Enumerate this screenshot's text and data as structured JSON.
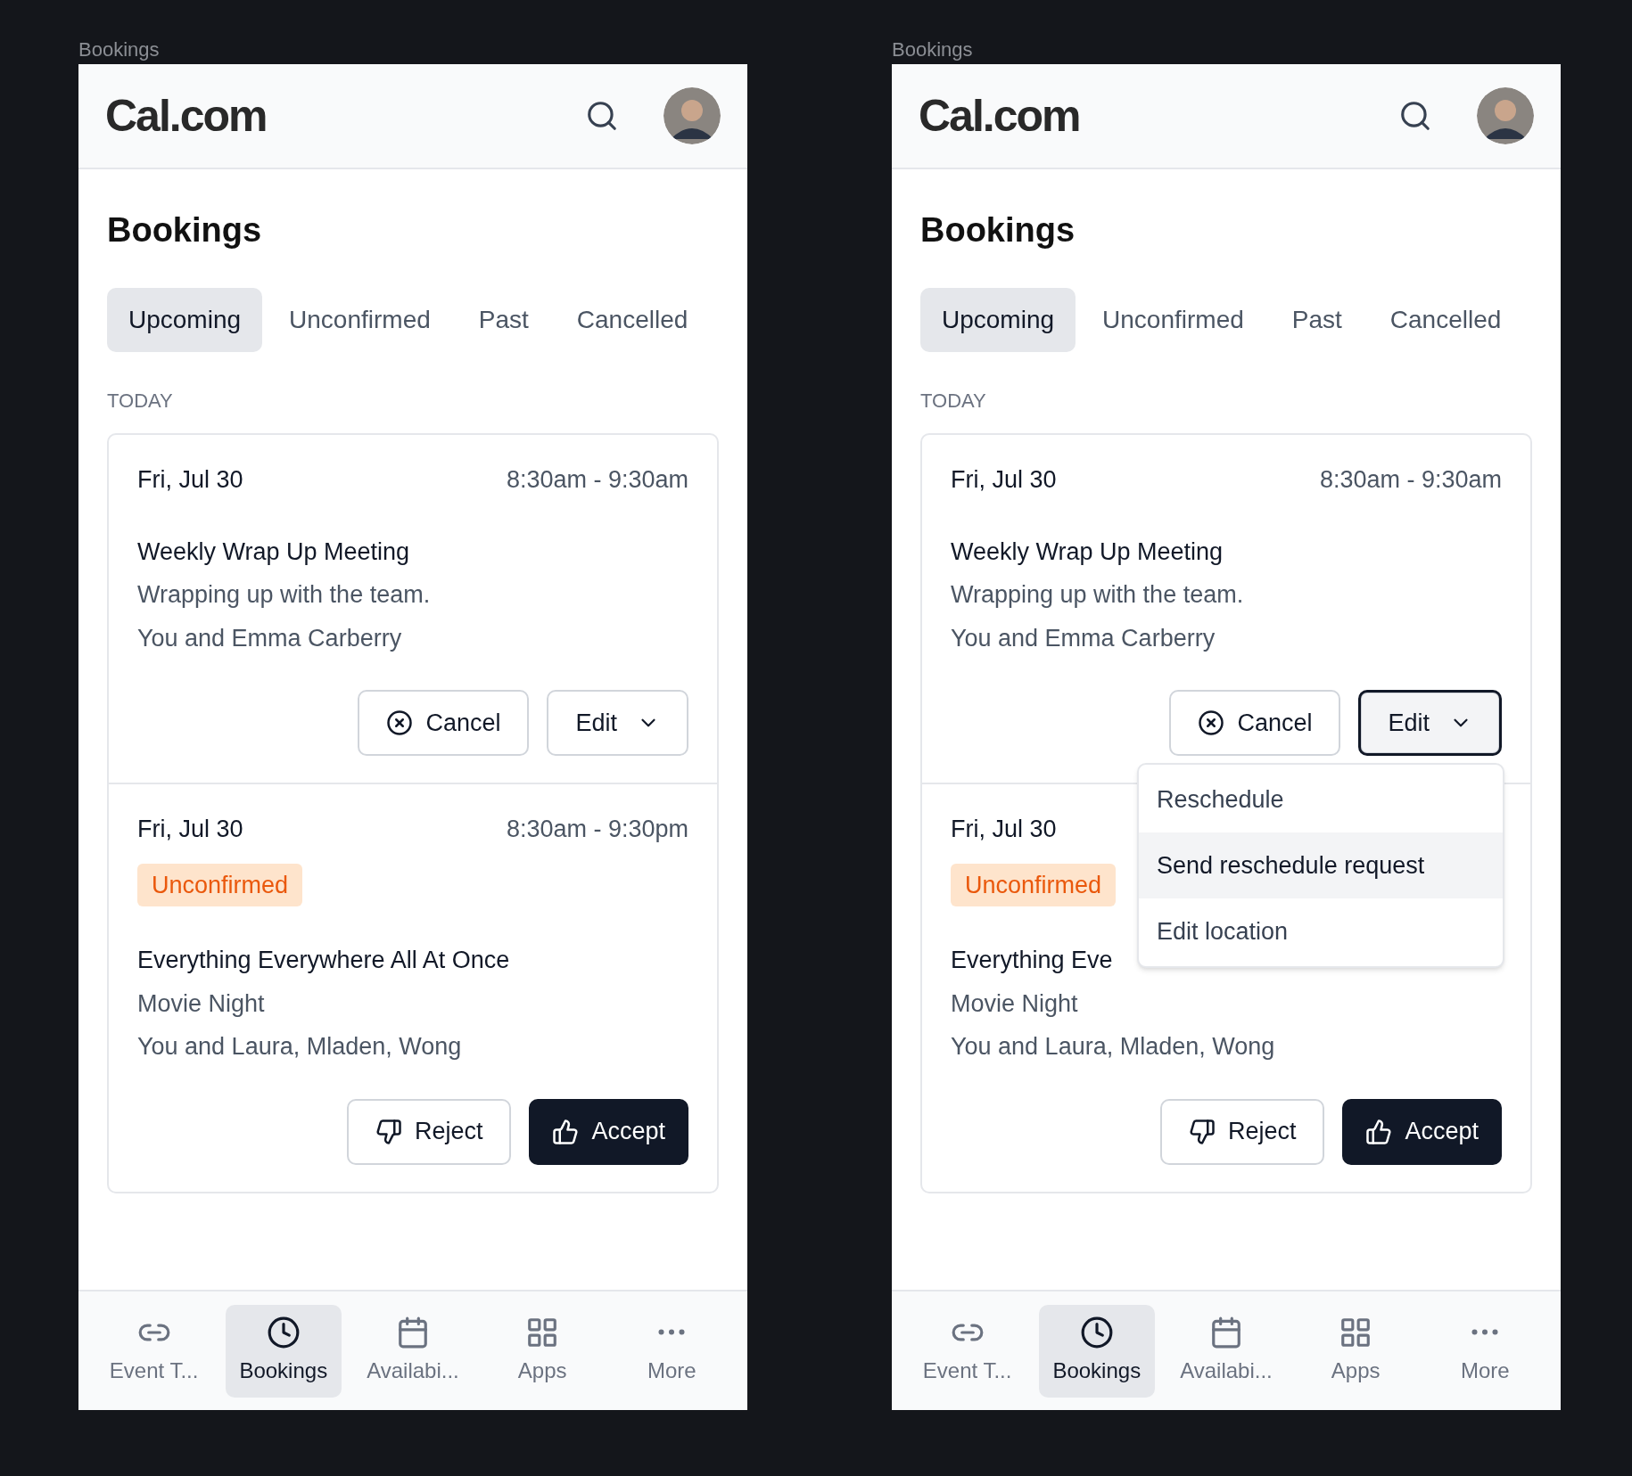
{
  "screens": [
    {
      "caption": "Bookings",
      "logo": "Cal.com",
      "title": "Bookings",
      "tabs": [
        {
          "label": "Upcoming",
          "selected": true
        },
        {
          "label": "Unconfirmed",
          "selected": false
        },
        {
          "label": "Past",
          "selected": false
        },
        {
          "label": "Cancelled",
          "selected": false
        }
      ],
      "section": "TODAY",
      "bookings": [
        {
          "date": "Fri, Jul 30",
          "time": "8:30am - 9:30am",
          "title": "Weekly Wrap Up Meeting",
          "description": "Wrapping up with the team.",
          "attendees": "You and Emma Carberry",
          "actions": [
            {
              "label": "Cancel",
              "kind": "cancel"
            },
            {
              "label": "Edit",
              "kind": "menu",
              "open": false
            }
          ]
        },
        {
          "date": "Fri, Jul 30",
          "time": "8:30am - 9:30pm",
          "badge": "Unconfirmed",
          "title": "Everything Everywhere All At Once",
          "description": "Movie Night",
          "attendees": "You and Laura, Mladen, Wong",
          "actions": [
            {
              "label": "Reject",
              "kind": "reject"
            },
            {
              "label": "Accept",
              "kind": "accept"
            }
          ]
        }
      ],
      "nav": [
        {
          "label": "Event T...",
          "kind": "link",
          "selected": false
        },
        {
          "label": "Bookings",
          "kind": "clock",
          "selected": true
        },
        {
          "label": "Availabi...",
          "kind": "calendar",
          "selected": false
        },
        {
          "label": "Apps",
          "kind": "grid",
          "selected": false
        },
        {
          "label": "More",
          "kind": "more",
          "selected": false
        }
      ]
    },
    {
      "caption": "Bookings",
      "logo": "Cal.com",
      "title": "Bookings",
      "tabs": [
        {
          "label": "Upcoming",
          "selected": true
        },
        {
          "label": "Unconfirmed",
          "selected": false
        },
        {
          "label": "Past",
          "selected": false
        },
        {
          "label": "Cancelled",
          "selected": false
        }
      ],
      "section": "TODAY",
      "bookings": [
        {
          "date": "Fri, Jul 30",
          "time": "8:30am - 9:30am",
          "title": "Weekly Wrap Up Meeting",
          "description": "Wrapping up with the team.",
          "attendees": "You and Emma Carberry",
          "actions": [
            {
              "label": "Cancel",
              "kind": "cancel"
            },
            {
              "label": "Edit",
              "kind": "menu",
              "open": true,
              "menu": [
                {
                  "label": "Reschedule",
                  "selected": false
                },
                {
                  "label": "Send reschedule request",
                  "selected": true
                },
                {
                  "label": "Edit location",
                  "selected": false
                }
              ]
            }
          ]
        },
        {
          "date": "Fri, Jul 30",
          "badge": "Unconfirmed",
          "title": "Everything Eve",
          "description": "Movie Night",
          "attendees": "You and Laura, Mladen, Wong",
          "actions": [
            {
              "label": "Reject",
              "kind": "reject"
            },
            {
              "label": "Accept",
              "kind": "accept"
            }
          ]
        }
      ],
      "nav": [
        {
          "label": "Event T...",
          "kind": "link",
          "selected": false
        },
        {
          "label": "Bookings",
          "kind": "clock",
          "selected": true
        },
        {
          "label": "Availabi...",
          "kind": "calendar",
          "selected": false
        },
        {
          "label": "Apps",
          "kind": "grid",
          "selected": false
        },
        {
          "label": "More",
          "kind": "more",
          "selected": false
        }
      ]
    }
  ]
}
